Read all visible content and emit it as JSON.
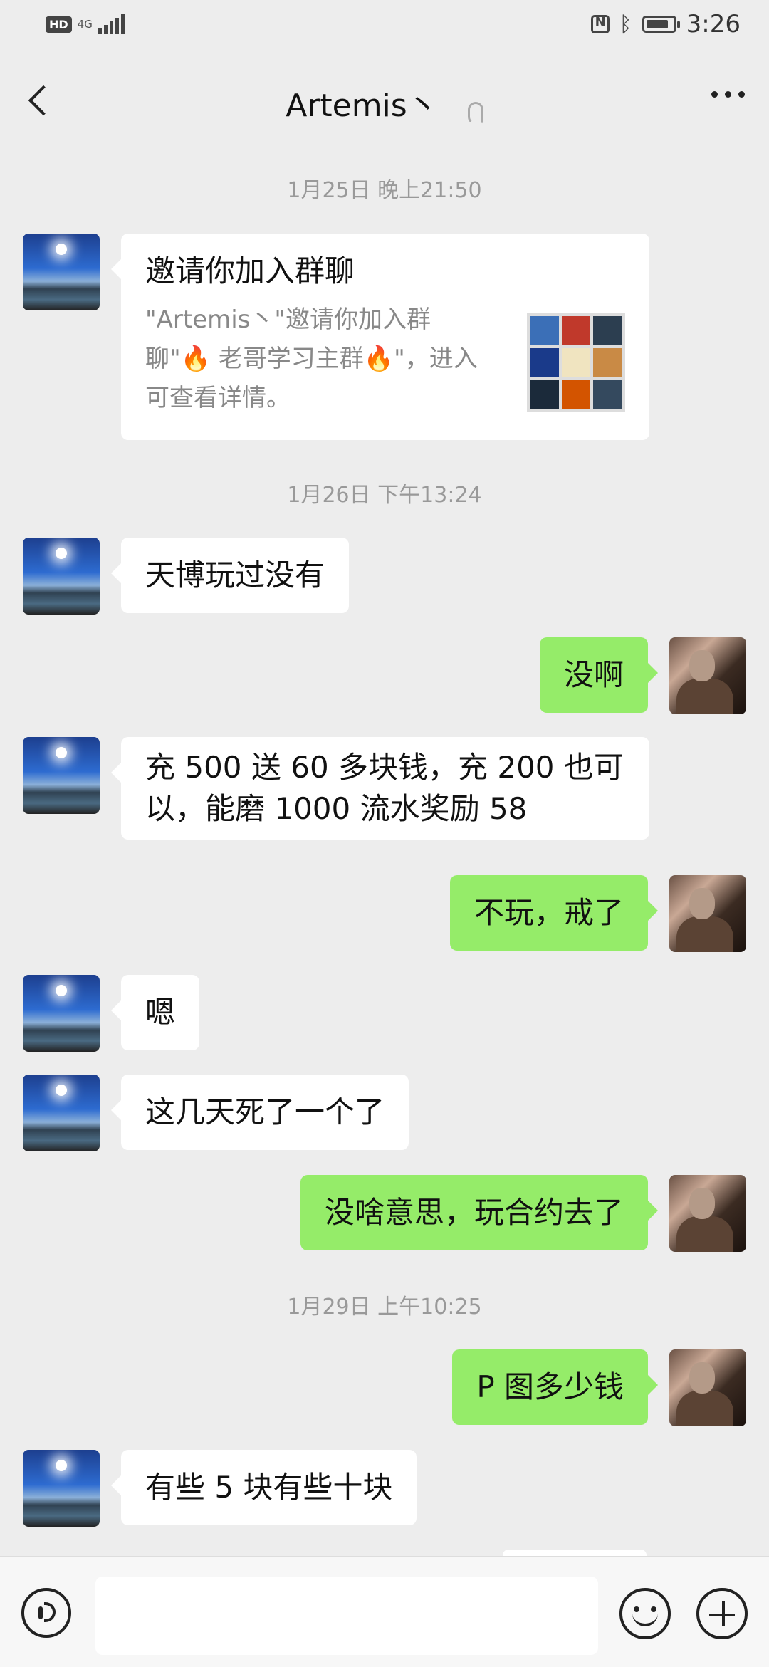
{
  "status_bar": {
    "hd": "HD",
    "network": "4G",
    "time": "3:26",
    "battery_level": 0.85
  },
  "header": {
    "title": "Artemis丶"
  },
  "messages": [
    {
      "type": "timestamp",
      "text": "1月25日 晚上21:50"
    },
    {
      "type": "card",
      "side": "in",
      "title": "邀请你加入群聊",
      "desc": "\"Artemis丶\"邀请你加入群聊\"🔥 老哥学习主群🔥\"，进入可查看详情。"
    },
    {
      "type": "timestamp",
      "text": "1月26日 下午13:24"
    },
    {
      "type": "text",
      "side": "in",
      "text": "天博玩过没有"
    },
    {
      "type": "text",
      "side": "out",
      "text": "没啊"
    },
    {
      "type": "text",
      "side": "in",
      "line1": "充 500 送 60 多块钱，充 200 也可",
      "line2": "以，能磨 1000 流水奖励 58"
    },
    {
      "type": "text",
      "side": "out",
      "text": "不玩，戒了"
    },
    {
      "type": "text",
      "side": "in",
      "text": "嗯"
    },
    {
      "type": "text",
      "side": "in",
      "text": "这几天死了一个了"
    },
    {
      "type": "text",
      "side": "out",
      "text": "没啥意思，玩合约去了"
    },
    {
      "type": "timestamp",
      "text": "1月29日 上午10:25"
    },
    {
      "type": "text",
      "side": "out",
      "text": "P 图多少钱"
    },
    {
      "type": "text",
      "side": "in",
      "text": "有些 5 块有些十块"
    }
  ],
  "input_bar": {
    "placeholder": ""
  },
  "icons": {
    "back": "chevron-left-icon",
    "ear": "ear-icon",
    "more": "more-icon",
    "voice": "voice-icon",
    "emoji": "emoji-icon",
    "plus": "plus-icon"
  },
  "colors": {
    "background": "#ededed",
    "incoming_bubble": "#ffffff",
    "outgoing_bubble": "#95ec69",
    "timestamp": "#999999"
  }
}
